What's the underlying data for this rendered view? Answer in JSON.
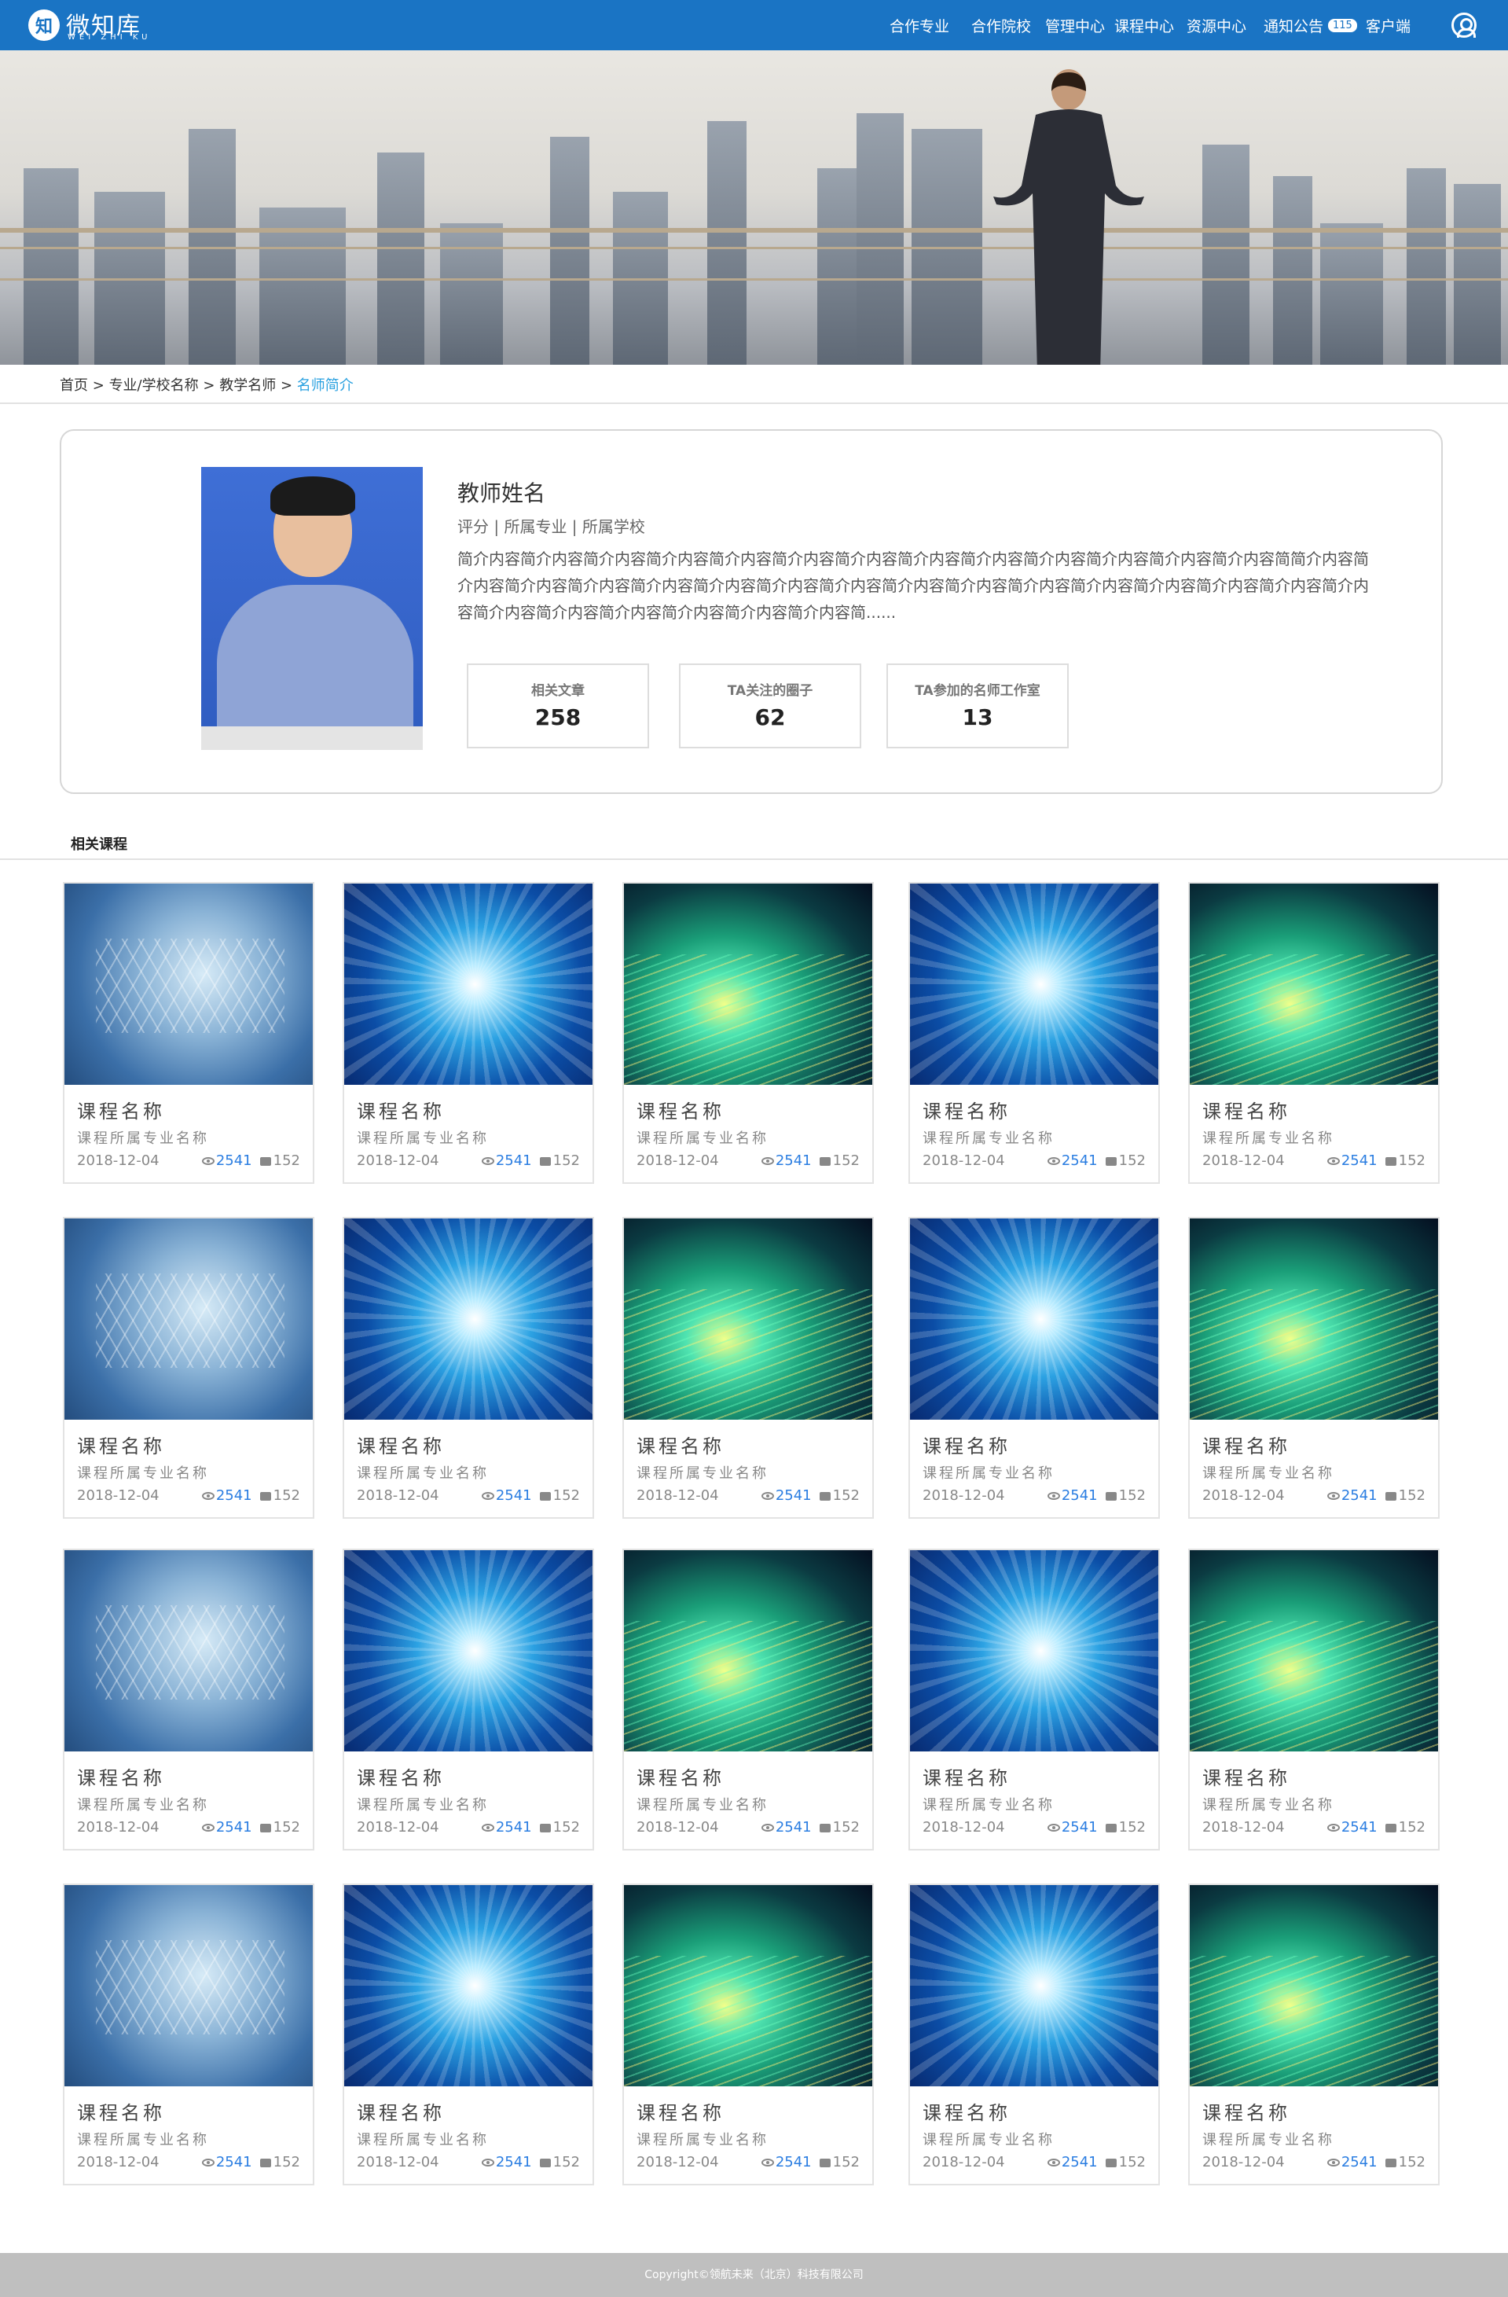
{
  "header": {
    "logo_mark": "知",
    "logo_text": "微知库",
    "logo_sub": "WEI ZHI KU",
    "nav": [
      "合作专业",
      "合作院校",
      "管理中心",
      "课程中心",
      "资源中心",
      "通知公告",
      "客户端"
    ],
    "notice_count": "115"
  },
  "breadcrumb": {
    "items": [
      "首页",
      "专业/学校名称",
      "教学名师"
    ],
    "sep": ">",
    "current": "名师简介"
  },
  "teacher": {
    "name": "教师姓名",
    "meta": "评分 | 所属专业 | 所属学校",
    "intro": "简介内容简介内容简介内容简介内容简介内容简介内容简介内容简介内容简介内容简介内容简介内容简介内容简介内容简简介内容简介内容简介内容简介内容简介内容简介内容简介内容简介内容简介内容简介内容简介内容简介内容简介内容简介内容简介内容简介内容简介内容简介内容简介内容简介内容简介内容简介内容简......",
    "stats": [
      {
        "label": "相关文章",
        "value": "258"
      },
      {
        "label": "TA关注的圈子",
        "value": "62"
      },
      {
        "label": "TA参加的名师工作室",
        "value": "13"
      }
    ]
  },
  "section": {
    "title": "相关课程"
  },
  "course": {
    "name": "课程名称",
    "major": "课程所属专业名称",
    "date": "2018-12-04",
    "views": "2541",
    "comments": "152"
  },
  "footer": {
    "copyright": "Copyright©领航未来（北京）科技有限公司"
  }
}
